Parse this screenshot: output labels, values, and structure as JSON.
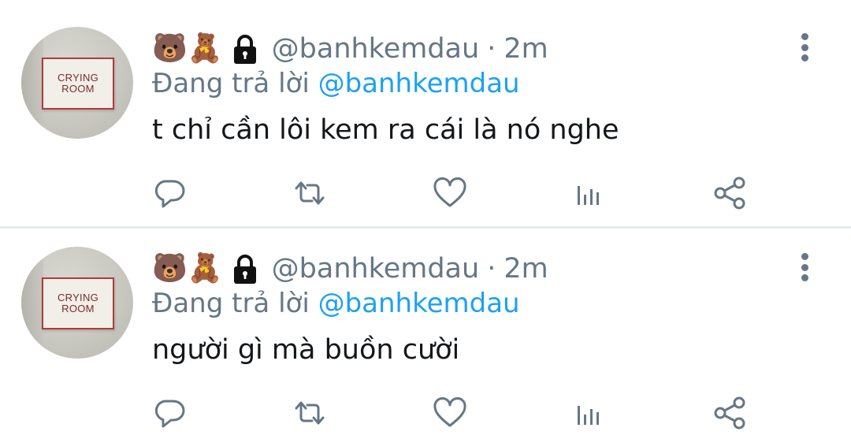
{
  "tweets": [
    {
      "avatar_sign": {
        "line1": "CRYING",
        "line2": "ROOM"
      },
      "name_emojis": "🐻🧸",
      "handle": "@banhkemdau",
      "separator": "·",
      "time": "2m",
      "reply_prefix": "Đang trả lời",
      "reply_to": "@banhkemdau",
      "text": "t chỉ cần lôi kem ra cái là nó nghe"
    },
    {
      "avatar_sign": {
        "line1": "CRYING",
        "line2": "ROOM"
      },
      "name_emojis": "🐻🧸",
      "handle": "@banhkemdau",
      "separator": "·",
      "time": "2m",
      "reply_prefix": "Đang trả lời",
      "reply_to": "@banhkemdau",
      "text": "người gì mà buồn cười"
    }
  ],
  "icons": [
    "lock-icon",
    "more-vertical-icon",
    "reply-icon",
    "retweet-icon",
    "like-icon",
    "analytics-icon",
    "share-icon"
  ],
  "colors": {
    "secondary_text": "#657786",
    "link": "#1da1f2",
    "primary_text": "#14171a",
    "divider": "#e6ecf0"
  }
}
